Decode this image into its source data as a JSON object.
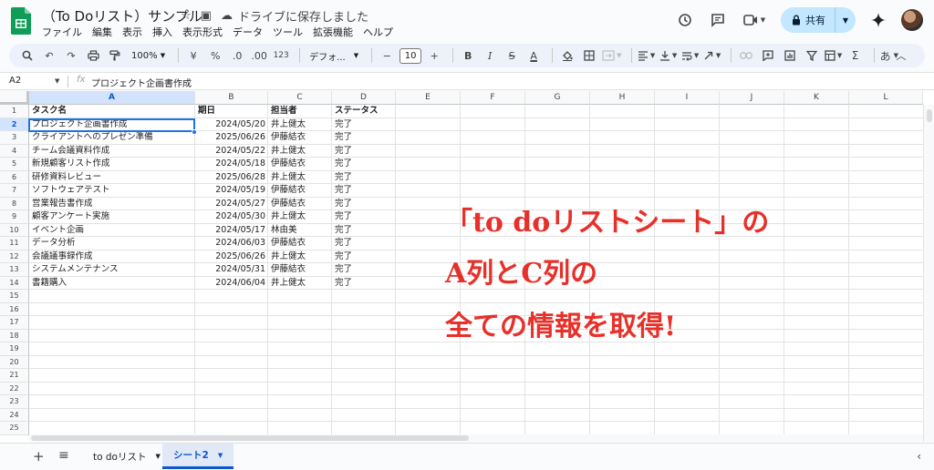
{
  "title": {
    "doc_title": "（To Doリスト）サンプル",
    "saved_status": "ドライブに保存しました",
    "menus": [
      "ファイル",
      "編集",
      "表示",
      "挿入",
      "表示形式",
      "データ",
      "ツール",
      "拡張機能",
      "ヘルプ"
    ],
    "share_label": "共有"
  },
  "toolbar": {
    "zoom": "100%",
    "currency": "¥",
    "percent": "%",
    "dec_decrease": ".0",
    "dec_increase": ".00",
    "number_format": "123",
    "font": "デフォ...",
    "font_size": "10",
    "bold": "B",
    "italic": "I",
    "strike": "S",
    "font_color": "A",
    "input_tools": "あ"
  },
  "formula_bar": {
    "cell_ref": "A2",
    "fx": "fx",
    "value": "プロジェクト企画書作成"
  },
  "columns": [
    "A",
    "B",
    "C",
    "D",
    "E",
    "F",
    "G",
    "H",
    "I",
    "J",
    "K",
    "L"
  ],
  "rows": [
    "1",
    "2",
    "3",
    "4",
    "5",
    "6",
    "7",
    "8",
    "9",
    "10",
    "11",
    "12",
    "13",
    "14",
    "15",
    "16",
    "17",
    "18",
    "19",
    "20",
    "21",
    "22",
    "23",
    "24",
    "25"
  ],
  "table": {
    "headers": [
      "タスク名",
      "期日",
      "担当者",
      "ステータス"
    ],
    "rows": [
      [
        "プロジェクト企画書作成",
        "2024/05/20",
        "井上健太",
        "完了"
      ],
      [
        "クライアントへのプレゼン準備",
        "2025/06/26",
        "伊藤結衣",
        "完了"
      ],
      [
        "チーム会議資料作成",
        "2024/05/22",
        "井上健太",
        "完了"
      ],
      [
        "新規顧客リスト作成",
        "2024/05/18",
        "伊藤結衣",
        "完了"
      ],
      [
        "研修資料レビュー",
        "2025/06/28",
        "井上健太",
        "完了"
      ],
      [
        "ソフトウェアテスト",
        "2024/05/19",
        "伊藤結衣",
        "完了"
      ],
      [
        "営業報告書作成",
        "2024/05/27",
        "伊藤結衣",
        "完了"
      ],
      [
        "顧客アンケート実施",
        "2024/05/30",
        "井上健太",
        "完了"
      ],
      [
        "イベント企画",
        "2024/05/17",
        "林由美",
        "完了"
      ],
      [
        "データ分析",
        "2024/06/03",
        "伊藤結衣",
        "完了"
      ],
      [
        "会議議事録作成",
        "2025/06/26",
        "井上健太",
        "完了"
      ],
      [
        "システムメンテナンス",
        "2024/05/31",
        "伊藤結衣",
        "完了"
      ],
      [
        "書籍購入",
        "2024/06/04",
        "井上健太",
        "完了"
      ]
    ]
  },
  "overlay": {
    "line1": "「to doリストシート」の",
    "line2": "A列とC列の",
    "line3": "全ての情報を取得!"
  },
  "sheets": {
    "tabs": [
      "to doリスト",
      "シート2"
    ],
    "active_index": 1
  },
  "colors": {
    "accent": "#0b57d0",
    "overlay_red": "#e8302a",
    "selection": "#d3e3fd"
  }
}
